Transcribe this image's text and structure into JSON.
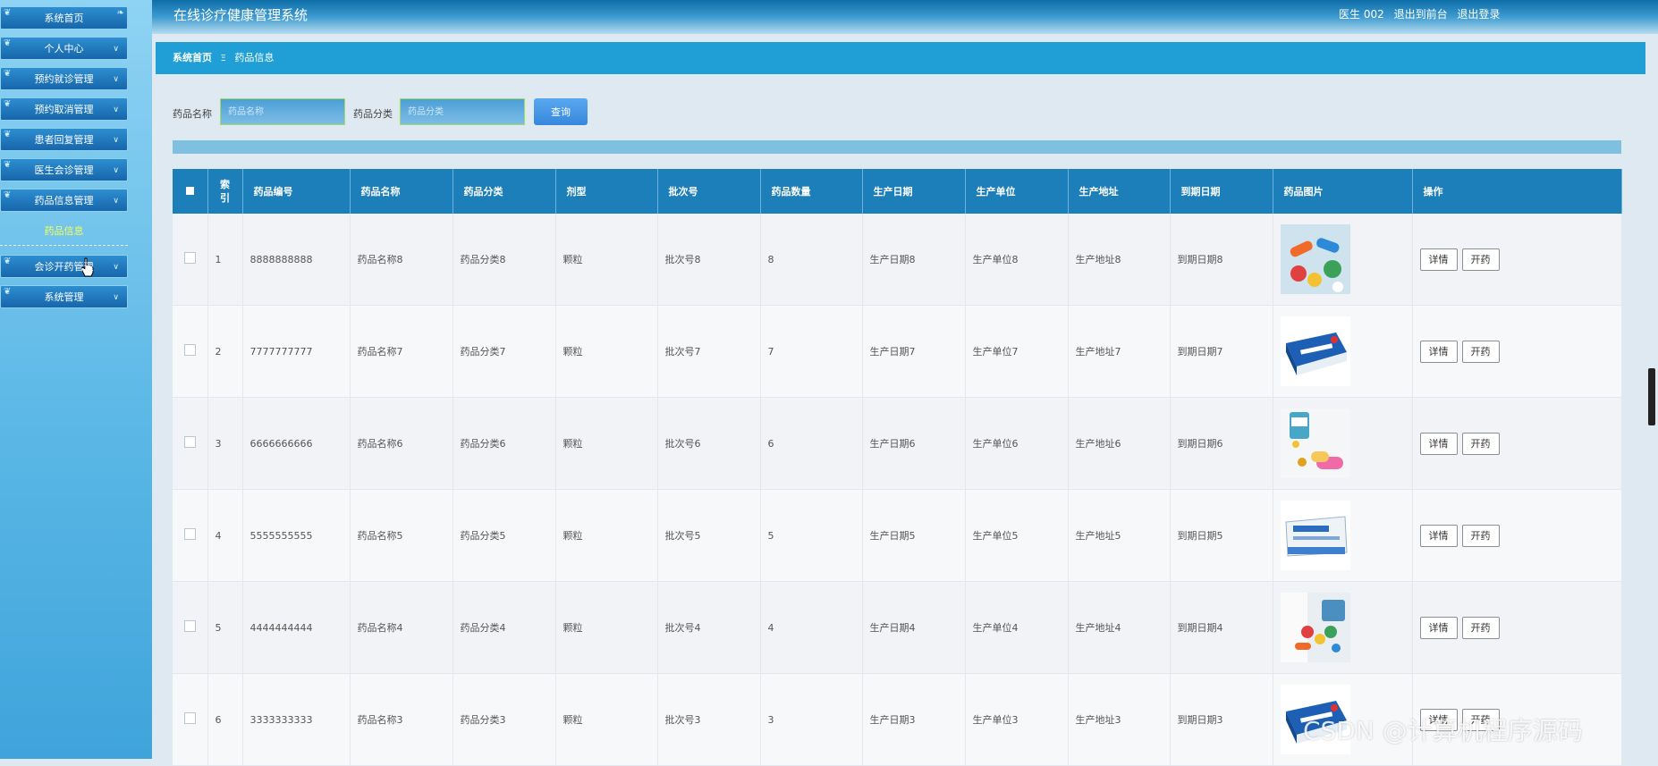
{
  "header": {
    "title": "在线诊疗健康管理系统",
    "user": "医生 002",
    "to_front": "退出到前台",
    "logout": "退出登录"
  },
  "sidebar": {
    "items": [
      {
        "label": "系统首页",
        "has_chevron": false
      },
      {
        "label": "个人中心",
        "has_chevron": true
      },
      {
        "label": "预约就诊管理",
        "has_chevron": true
      },
      {
        "label": "预约取消管理",
        "has_chevron": true
      },
      {
        "label": "患者回复管理",
        "has_chevron": true
      },
      {
        "label": "医生会诊管理",
        "has_chevron": true
      },
      {
        "label": "药品信息管理",
        "has_chevron": true
      }
    ],
    "sub_item": "药品信息",
    "items_after": [
      {
        "label": "会诊开药管理",
        "has_chevron": true
      },
      {
        "label": "系统管理",
        "has_chevron": true
      }
    ]
  },
  "breadcrumb": {
    "home": "系统首页",
    "sep": "Ξ",
    "current": "药品信息"
  },
  "search": {
    "name_label": "药品名称",
    "name_placeholder": "药品名称",
    "category_label": "药品分类",
    "category_placeholder": "药品分类",
    "button": "查询"
  },
  "table": {
    "headers": [
      "索引",
      "药品编号",
      "药品名称",
      "药品分类",
      "剂型",
      "批次号",
      "药品数量",
      "生产日期",
      "生产单位",
      "生产地址",
      "到期日期",
      "药品图片",
      "操作"
    ],
    "index_header_lines": [
      "索",
      "引"
    ],
    "rows": [
      {
        "index": "1",
        "code": "8888888888",
        "name": "药品名称8",
        "category": "药品分类8",
        "form": "颗粒",
        "batch": "批次号8",
        "qty": "8",
        "prod_date": "生产日期8",
        "unit": "生产单位8",
        "address": "生产地址8",
        "expire": "到期日期8",
        "image": "pills-colorful"
      },
      {
        "index": "2",
        "code": "7777777777",
        "name": "药品名称7",
        "category": "药品分类7",
        "form": "颗粒",
        "batch": "批次号7",
        "qty": "7",
        "prod_date": "生产日期7",
        "unit": "生产单位7",
        "address": "生产地址7",
        "expire": "到期日期7",
        "image": "medicine-box-blue"
      },
      {
        "index": "3",
        "code": "6666666666",
        "name": "药品名称6",
        "category": "药品分类6",
        "form": "颗粒",
        "batch": "批次号6",
        "qty": "6",
        "prod_date": "生产日期6",
        "unit": "生产单位6",
        "address": "生产地址6",
        "expire": "到期日期6",
        "image": "pill-bottles"
      },
      {
        "index": "4",
        "code": "5555555555",
        "name": "药品名称5",
        "category": "药品分类5",
        "form": "颗粒",
        "batch": "批次号5",
        "qty": "5",
        "prod_date": "生产日期5",
        "unit": "生产单位5",
        "address": "生产地址5",
        "expire": "到期日期5",
        "image": "medicine-box-white"
      },
      {
        "index": "5",
        "code": "4444444444",
        "name": "药品名称4",
        "category": "药品分类4",
        "form": "颗粒",
        "batch": "批次号4",
        "qty": "4",
        "prod_date": "生产日期4",
        "unit": "生产单位4",
        "address": "生产地址4",
        "expire": "到期日期4",
        "image": "doctor-pills"
      },
      {
        "index": "6",
        "code": "3333333333",
        "name": "药品名称3",
        "category": "药品分类3",
        "form": "颗粒",
        "batch": "批次号3",
        "qty": "3",
        "prod_date": "生产日期3",
        "unit": "生产单位3",
        "address": "生产地址3",
        "expire": "到期日期3",
        "image": "medicine-box-blue"
      }
    ],
    "detail_button": "详情",
    "prescribe_button": "开药"
  },
  "watermark": "CSDN @计算机程序源码",
  "colors": {
    "header": "#1d7fba",
    "breadcrumb": "#1f9fd6",
    "search_button": "#3687dd",
    "active_sub": "#f4ff58"
  }
}
